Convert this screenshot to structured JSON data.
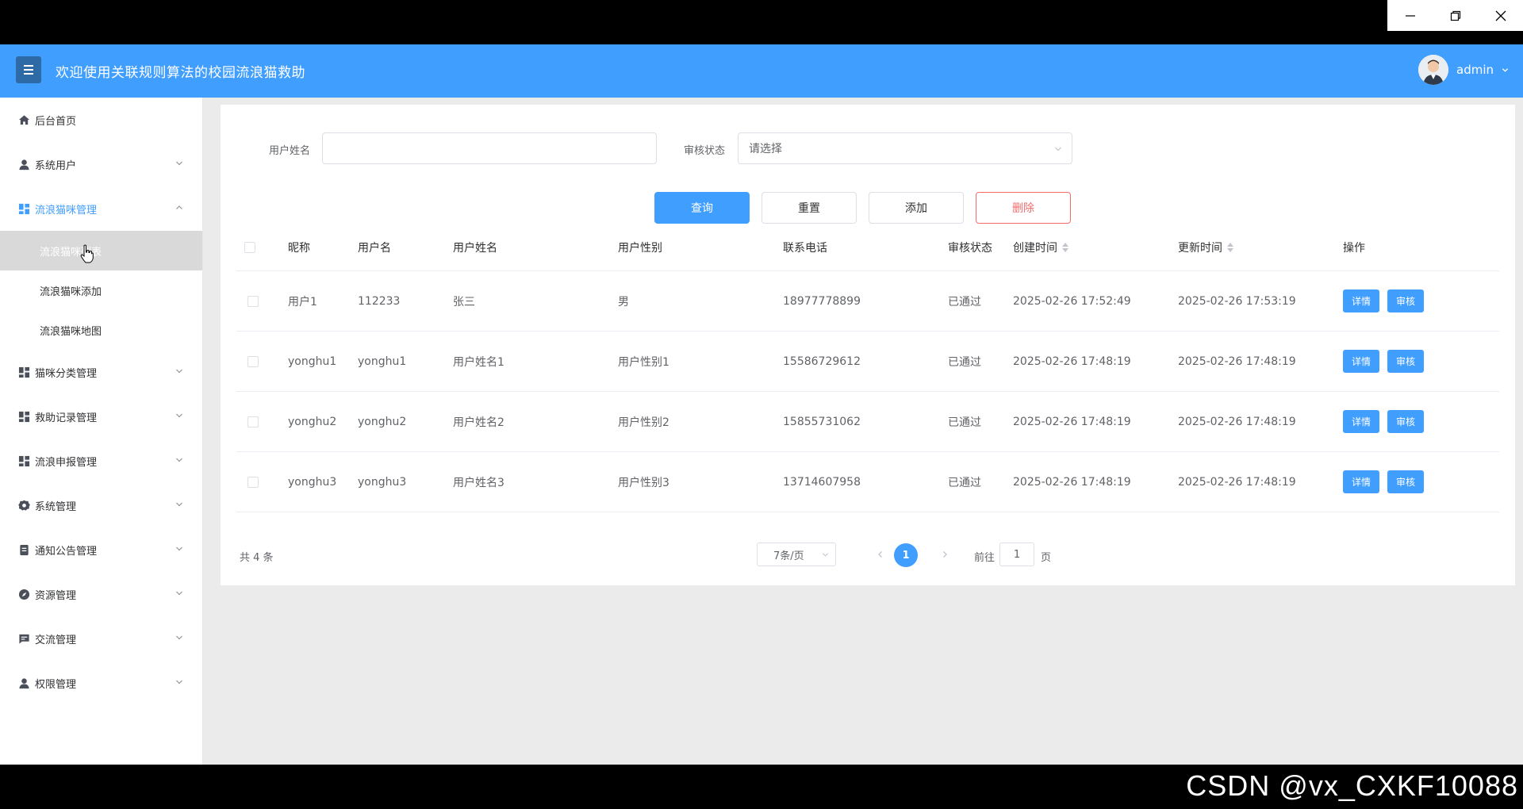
{
  "window": {
    "controls": [
      "minimize-icon",
      "restore-icon",
      "close-icon"
    ]
  },
  "header": {
    "title": "欢迎使用关联规则算法的校园流浪猫救助",
    "user_name": "admin",
    "accent_color": "#409eff"
  },
  "sidebar": {
    "items": [
      {
        "label": "后台首页",
        "icon": "home-icon"
      },
      {
        "label": "系统用户",
        "icon": "user-icon"
      },
      {
        "label": "流浪猫咪管理",
        "icon": "grid-icon",
        "expanded": true,
        "children": [
          {
            "label": "流浪猫咪列表",
            "selected": true
          },
          {
            "label": "流浪猫咪添加"
          },
          {
            "label": "流浪猫咪地图"
          }
        ]
      },
      {
        "label": "猫咪分类管理",
        "icon": "grid-icon"
      },
      {
        "label": "救助记录管理",
        "icon": "grid-icon"
      },
      {
        "label": "流浪申报管理",
        "icon": "grid-icon"
      },
      {
        "label": "系统管理",
        "icon": "gear-icon"
      },
      {
        "label": "通知公告管理",
        "icon": "document-icon"
      },
      {
        "label": "资源管理",
        "icon": "compass-icon"
      },
      {
        "label": "交流管理",
        "icon": "chat-icon"
      },
      {
        "label": "权限管理",
        "icon": "user-icon"
      }
    ]
  },
  "search": {
    "name_label": "用户姓名",
    "name_value": "",
    "status_label": "审核状态",
    "status_placeholder": "请选择"
  },
  "actions": {
    "query": "查询",
    "reset": "重置",
    "add": "添加",
    "delete": "删除"
  },
  "table": {
    "columns": [
      "昵称",
      "用户名",
      "用户姓名",
      "用户性别",
      "联系电话",
      "审核状态",
      "创建时间",
      "更新时间",
      "操作"
    ],
    "rows": [
      {
        "nickname": "用户1",
        "username": "112233",
        "realname": "张三",
        "gender": "男",
        "phone": "18977778899",
        "status": "已通过",
        "created": "2025-02-26 17:52:49",
        "updated": "2025-02-26 17:53:19"
      },
      {
        "nickname": "yonghu1",
        "username": "yonghu1",
        "realname": "用户姓名1",
        "gender": "用户性别1",
        "phone": "15586729612",
        "status": "已通过",
        "created": "2025-02-26 17:48:19",
        "updated": "2025-02-26 17:48:19"
      },
      {
        "nickname": "yonghu2",
        "username": "yonghu2",
        "realname": "用户姓名2",
        "gender": "用户性别2",
        "phone": "15855731062",
        "status": "已通过",
        "created": "2025-02-26 17:48:19",
        "updated": "2025-02-26 17:48:19"
      },
      {
        "nickname": "yonghu3",
        "username": "yonghu3",
        "realname": "用户姓名3",
        "gender": "用户性别3",
        "phone": "13714607958",
        "status": "已通过",
        "created": "2025-02-26 17:48:19",
        "updated": "2025-02-26 17:48:19"
      }
    ],
    "row_actions": {
      "detail": "详情",
      "review": "审核"
    }
  },
  "pagination": {
    "total": "共 4 条",
    "page_size": "7条/页",
    "current_page": "1",
    "goto_label": "前往",
    "goto_value": "1",
    "goto_unit": "页"
  },
  "watermark": "CSDN @vx_CXKF10088"
}
